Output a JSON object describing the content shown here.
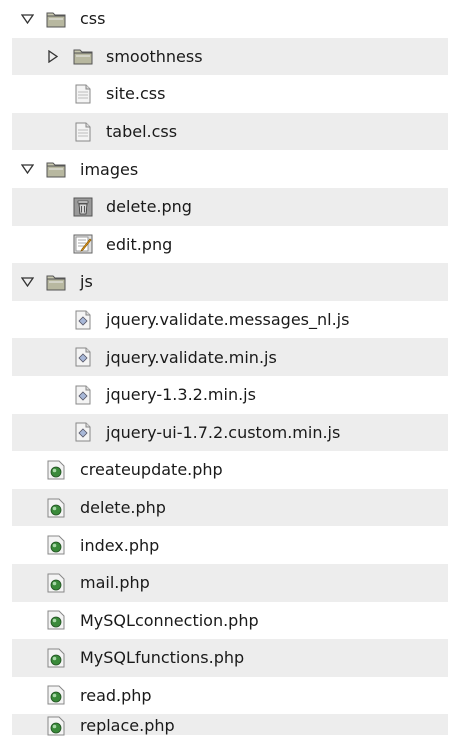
{
  "tree": {
    "css": {
      "label": "css",
      "expanded": true,
      "children": {
        "smoothness": {
          "label": "smoothness",
          "expanded": false
        },
        "site": {
          "label": "site.css"
        },
        "tabel": {
          "label": "tabel.css"
        }
      }
    },
    "images": {
      "label": "images",
      "expanded": true,
      "children": {
        "delete": {
          "label": "delete.png"
        },
        "edit": {
          "label": "edit.png"
        }
      }
    },
    "js": {
      "label": "js",
      "expanded": true,
      "children": {
        "messages": {
          "label": "jquery.validate.messages_nl.js"
        },
        "validate": {
          "label": "jquery.validate.min.js"
        },
        "jquery": {
          "label": "jquery-1.3.2.min.js"
        },
        "jqueryui": {
          "label": "jquery-ui-1.7.2.custom.min.js"
        }
      }
    },
    "files": [
      {
        "label": "createupdate.php"
      },
      {
        "label": "delete.php"
      },
      {
        "label": "index.php"
      },
      {
        "label": "mail.php"
      },
      {
        "label": "MySQLconnection.php"
      },
      {
        "label": "MySQLfunctions.php"
      },
      {
        "label": "read.php"
      },
      {
        "label": "replace.php"
      }
    ]
  },
  "icons": {
    "folder": "folder-icon",
    "css_file": "text-file-icon",
    "trash_image": "trash-image-icon",
    "edit_image": "edit-image-icon",
    "js_file": "javascript-file-icon",
    "php_file": "php-file-icon"
  },
  "colors": {
    "row_alt": "#ededed",
    "folder_fill": "#b8b8a0",
    "php_green": "#3a8a3a"
  }
}
